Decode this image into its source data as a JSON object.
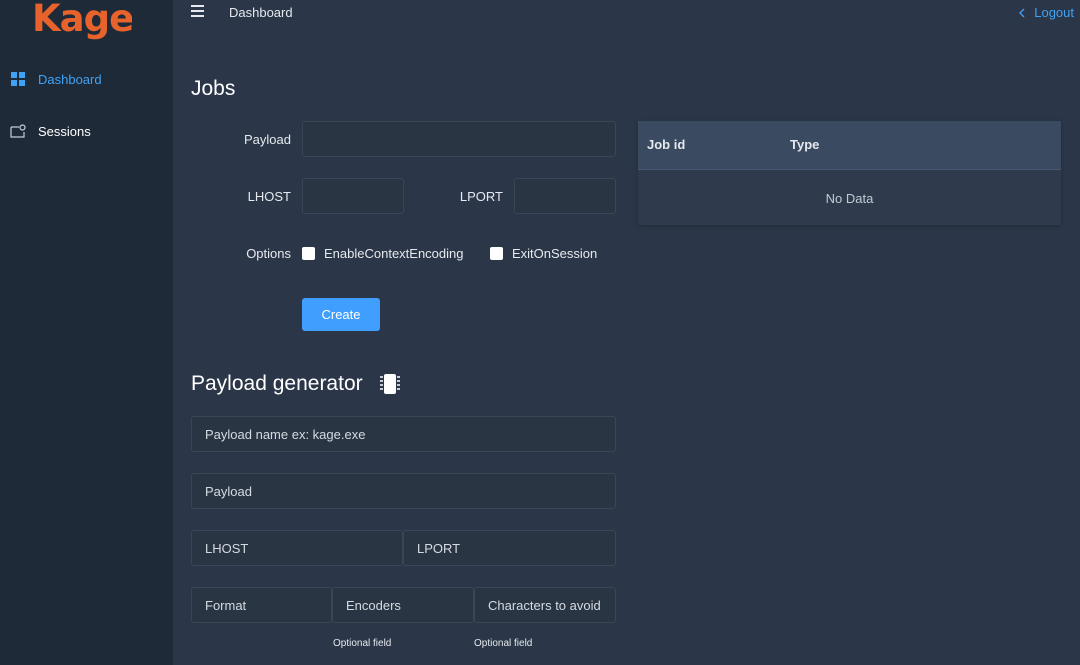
{
  "logo": {
    "text": "Kage",
    "color": "#e8632b"
  },
  "sidebar": {
    "items": [
      {
        "label": "Dashboard",
        "icon": "grid-icon",
        "active": true
      },
      {
        "label": "Sessions",
        "icon": "session-window-icon",
        "active": false
      }
    ]
  },
  "header": {
    "breadcrumb": "Dashboard",
    "logout_label": "Logout"
  },
  "jobs": {
    "title": "Jobs",
    "payload_label": "Payload",
    "lhost_label": "LHOST",
    "lport_label": "LPORT",
    "options_label": "Options",
    "option_1": "EnableContextEncoding",
    "option_2": "ExitOnSession",
    "create_label": "Create",
    "table": {
      "col_job_id": "Job id",
      "col_type": "Type",
      "empty_text": "No Data"
    }
  },
  "generator": {
    "title": "Payload generator",
    "name_placeholder": "Payload name ex: kage.exe",
    "payload_placeholder": "Payload",
    "lhost_placeholder": "LHOST",
    "lport_placeholder": "LPORT",
    "format_placeholder": "Format",
    "encoders_placeholder": "Encoders",
    "badchars_placeholder": "Characters to avoid",
    "encoders_hint": "Optional field",
    "badchars_hint": "Optional field"
  },
  "colors": {
    "accent": "#409eff",
    "link": "#3fa2f5",
    "sidebar_bg": "#1f2a38",
    "main_bg": "#2b3748"
  }
}
